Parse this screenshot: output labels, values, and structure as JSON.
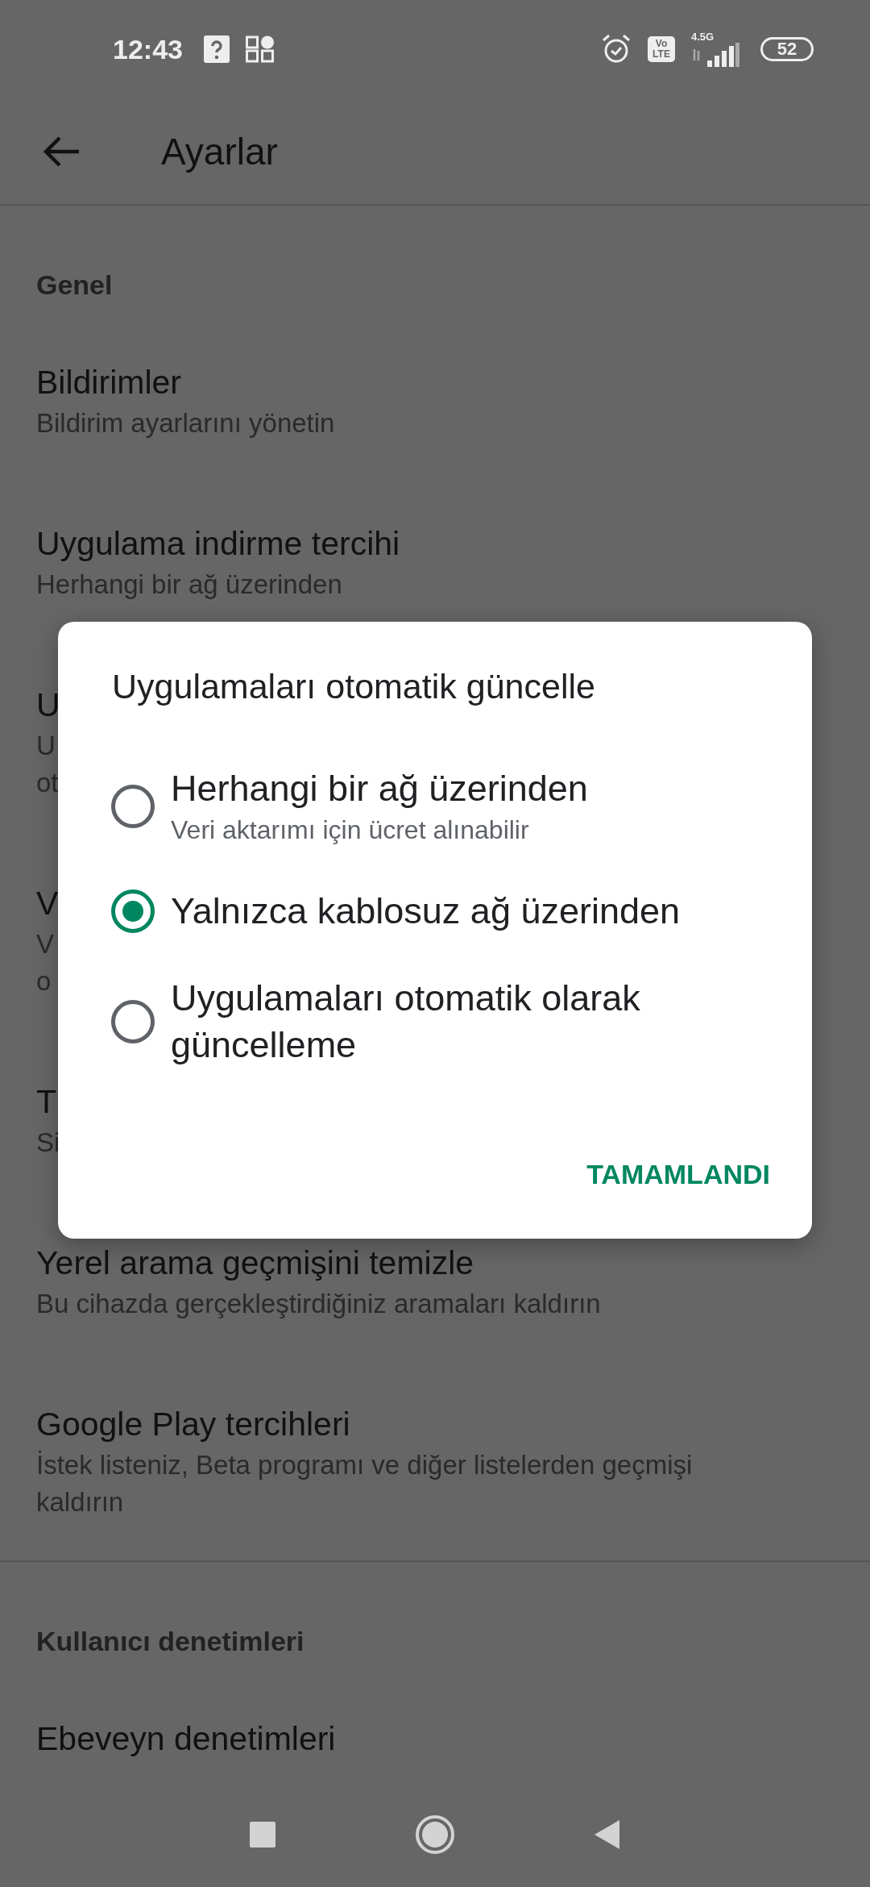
{
  "status_bar": {
    "time": "12:43",
    "lte_badge": [
      "Vo",
      "LTE"
    ],
    "network": "4.5G",
    "battery": "52"
  },
  "app_bar": {
    "title": "Ayarlar"
  },
  "sections": [
    {
      "header": "Genel",
      "items": [
        {
          "title": "Bildirimler",
          "subtitle_lines": [
            "Bildirim ayarlarını yönetin"
          ]
        },
        {
          "title": "Uygulama indirme tercihi",
          "subtitle_lines": [
            "Herhangi bir ağ üzerinden"
          ]
        },
        {
          "title": "U",
          "subtitle_lines": [
            "U",
            "ot"
          ]
        },
        {
          "title": "V",
          "subtitle_lines": [
            "V",
            "o"
          ]
        },
        {
          "title": "T",
          "subtitle_lines": [
            "Si"
          ]
        },
        {
          "title": "Yerel arama geçmişini temizle",
          "subtitle_lines": [
            "Bu cihazda gerçekleştirdiğiniz aramaları kaldırın"
          ]
        },
        {
          "title": "Google Play tercihleri",
          "subtitle_lines": [
            "İstek listeniz, Beta programı ve diğer listelerden geçmişi",
            "kaldırın"
          ]
        }
      ]
    },
    {
      "header": "Kullanıcı denetimleri",
      "items": [
        {
          "title": "Ebeveyn denetimleri"
        }
      ]
    }
  ],
  "dialog": {
    "title": "Uygulamaları otomatik güncelle",
    "options": [
      {
        "label": "Herhangi bir ağ üzerinden",
        "sublabel": "Veri aktarımı için ücret alınabilir",
        "selected": false
      },
      {
        "label": "Yalnızca kablosuz ağ üzerinden",
        "selected": true
      },
      {
        "label": "Uygulamaları otomatik olarak güncelleme",
        "selected": false
      }
    ],
    "button": "TAMAMLANDI"
  }
}
